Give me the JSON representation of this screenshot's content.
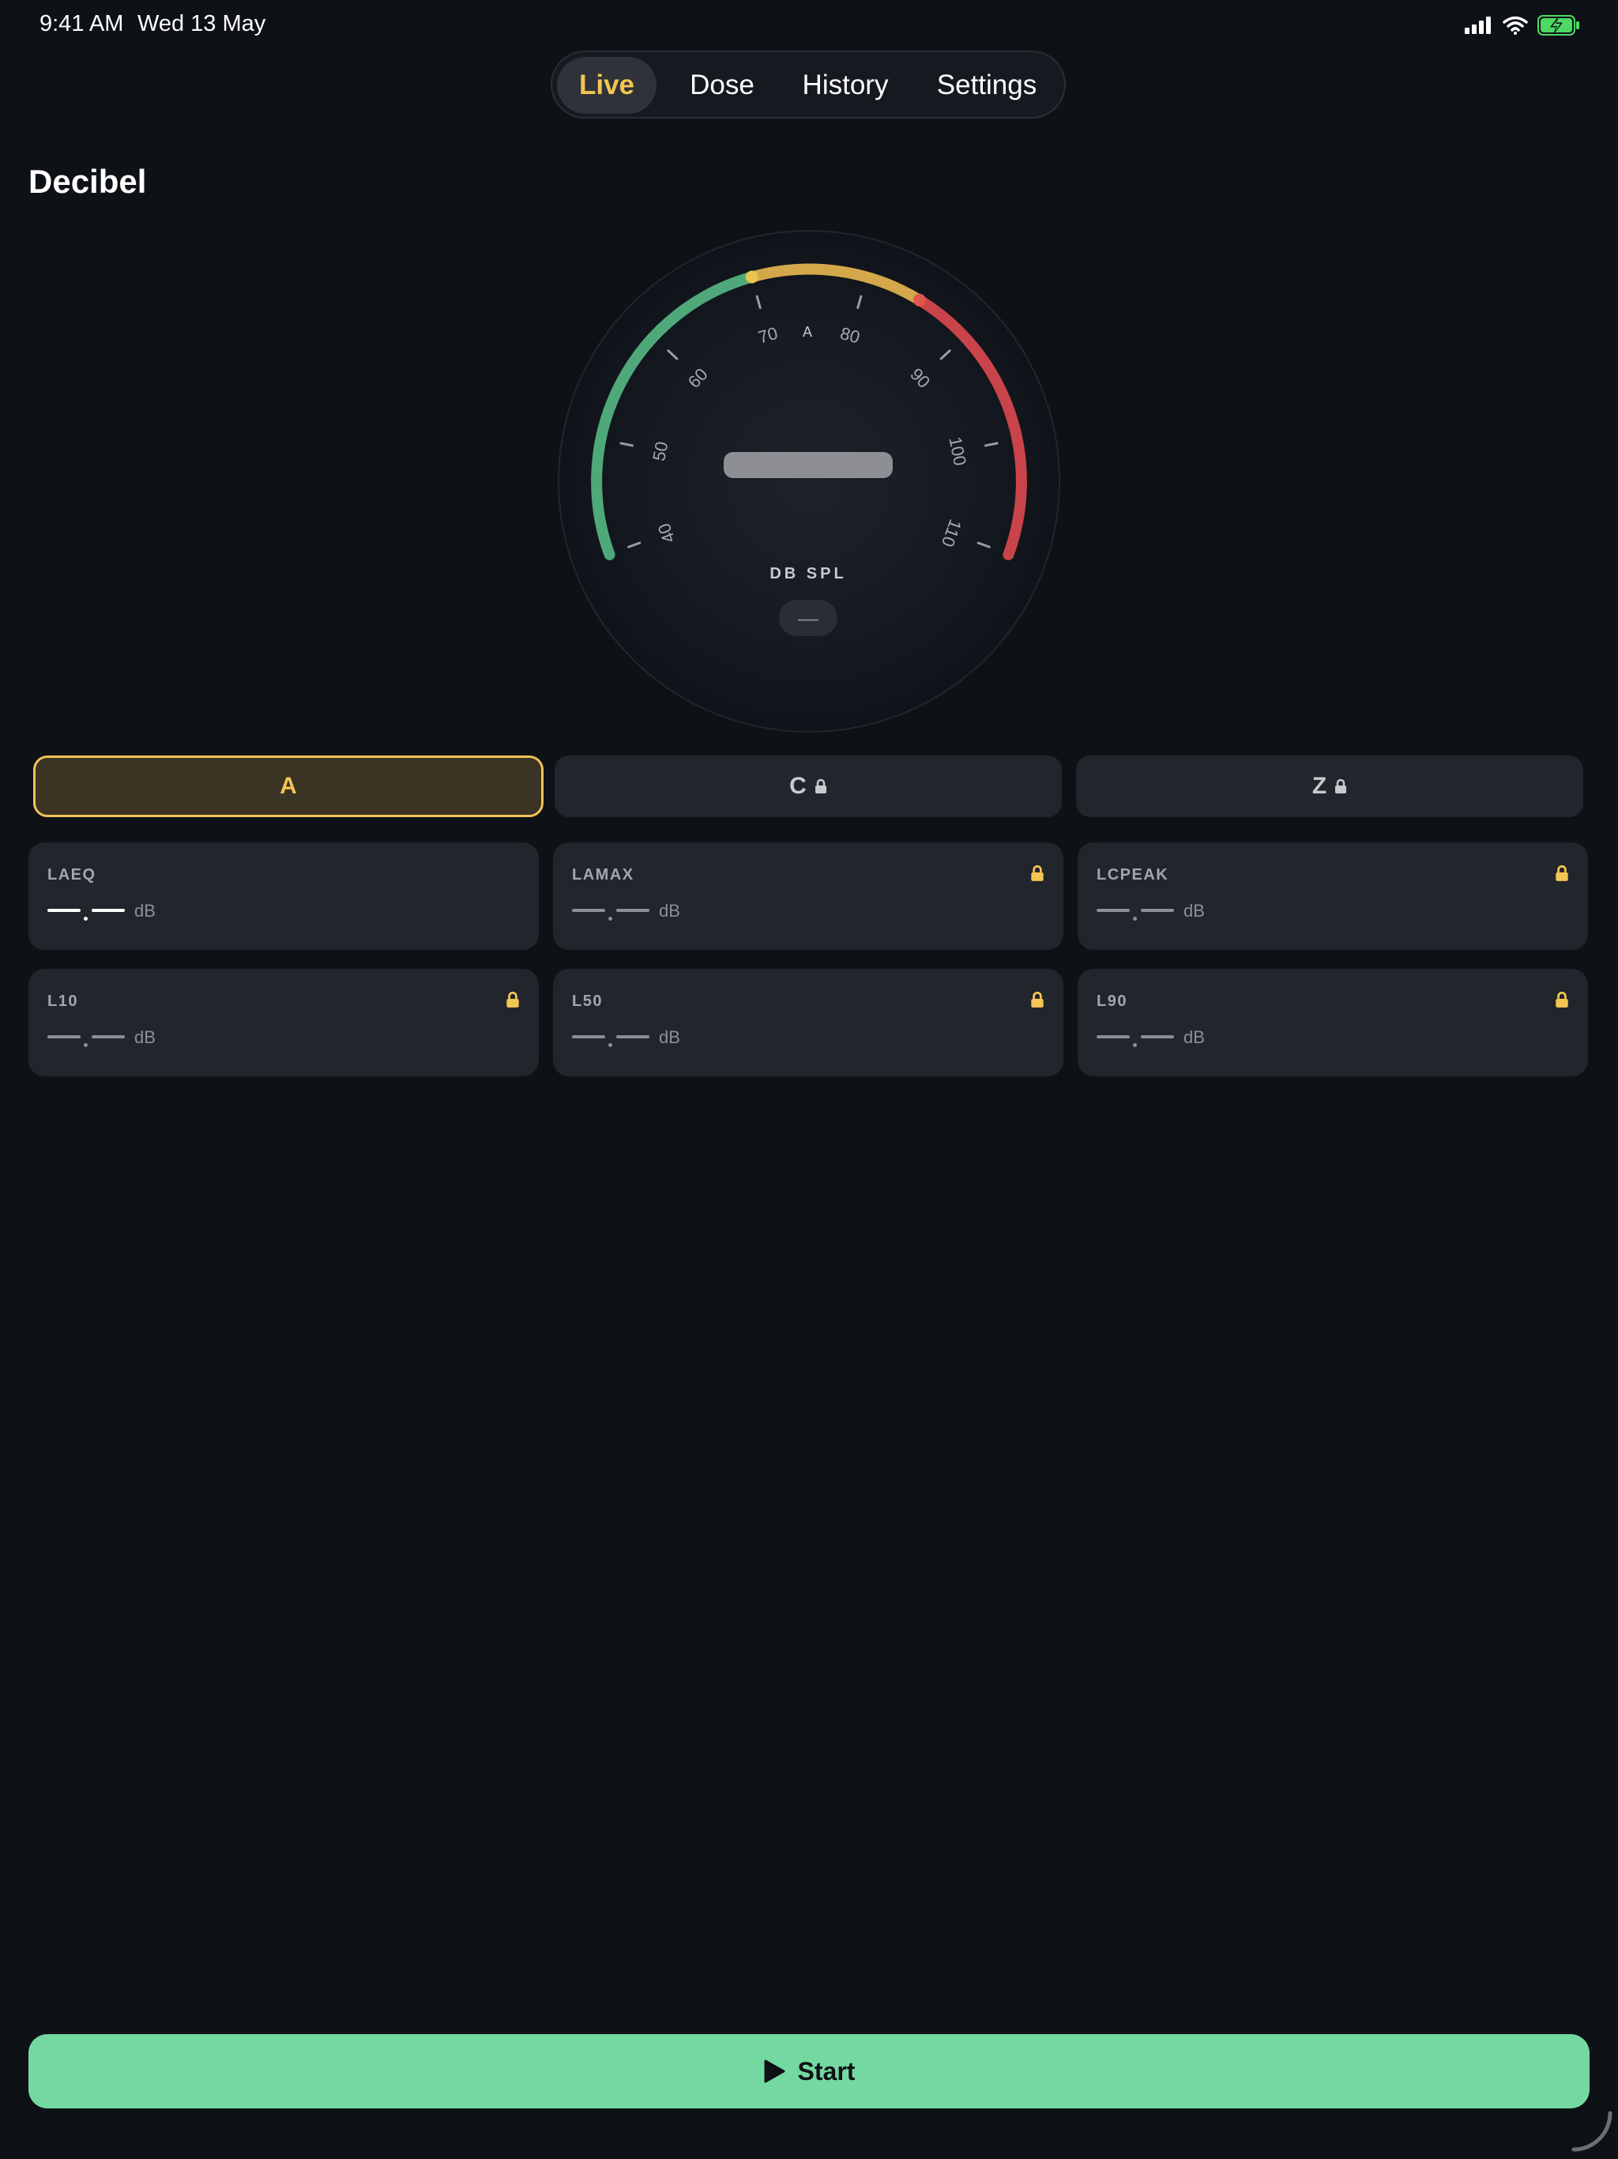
{
  "status_bar": {
    "time": "9:41 AM",
    "date": "Wed 13 May"
  },
  "tabs": [
    {
      "label": "Live",
      "active": true
    },
    {
      "label": "Dose",
      "active": false
    },
    {
      "label": "History",
      "active": false
    },
    {
      "label": "Settings",
      "active": false
    }
  ],
  "page_title": "Decibel",
  "gauge": {
    "tick_labels": [
      "40",
      "50",
      "60",
      "70",
      "80",
      "90",
      "100",
      "110"
    ],
    "weighting_indicator": "A",
    "unit_label": "DB SPL",
    "mode_value": "—",
    "colors": {
      "green": "#4fa87a",
      "yellow": "#d4a84a",
      "red": "#c9444a"
    }
  },
  "weightings": [
    {
      "label": "A",
      "locked": false,
      "selected": true
    },
    {
      "label": "C",
      "locked": true,
      "selected": false
    },
    {
      "label": "Z",
      "locked": true,
      "selected": false
    }
  ],
  "metrics": [
    {
      "label": "LAEQ",
      "unit": "dB",
      "locked": false
    },
    {
      "label": "LAMAX",
      "unit": "dB",
      "locked": true
    },
    {
      "label": "LCPEAK",
      "unit": "dB",
      "locked": true
    },
    {
      "label": "L10",
      "unit": "dB",
      "locked": true
    },
    {
      "label": "L50",
      "unit": "dB",
      "locked": true
    },
    {
      "label": "L90",
      "unit": "dB",
      "locked": true
    }
  ],
  "start_button": {
    "label": "Start",
    "icon": "play-icon"
  },
  "colors": {
    "accent": "#f3c552",
    "start": "#74d9a0",
    "lock": "#f3c552",
    "background": "#0e1116"
  }
}
